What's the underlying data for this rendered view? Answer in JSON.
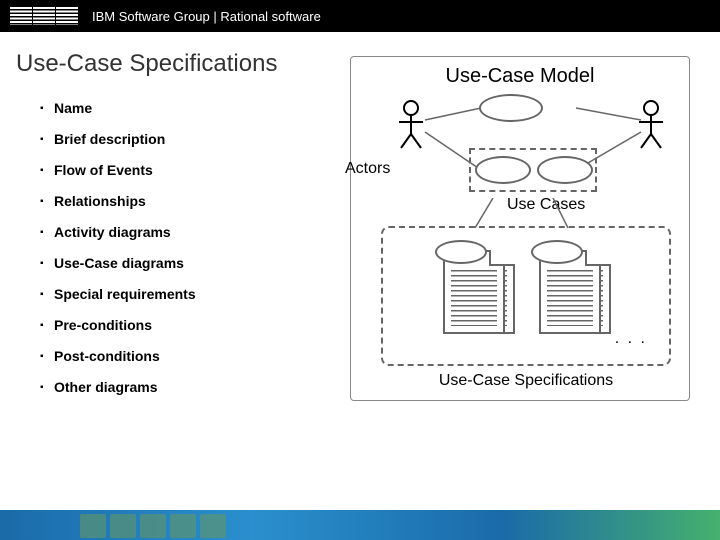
{
  "header": {
    "brand": "IBM",
    "text": "IBM Software Group | Rational software"
  },
  "title": "Use-Case Specifications",
  "bullets": [
    "Name",
    "Brief description",
    "Flow of Events",
    "Relationships",
    "Activity diagrams",
    "Use-Case diagrams",
    "Special requirements",
    "Pre-conditions",
    "Post-conditions",
    "Other diagrams"
  ],
  "model": {
    "title": "Use-Case Model",
    "actors_label": "Actors",
    "usecases_label": "Use Cases",
    "spec_label": "Use-Case Specifications",
    "ellipsis": ". . ."
  }
}
